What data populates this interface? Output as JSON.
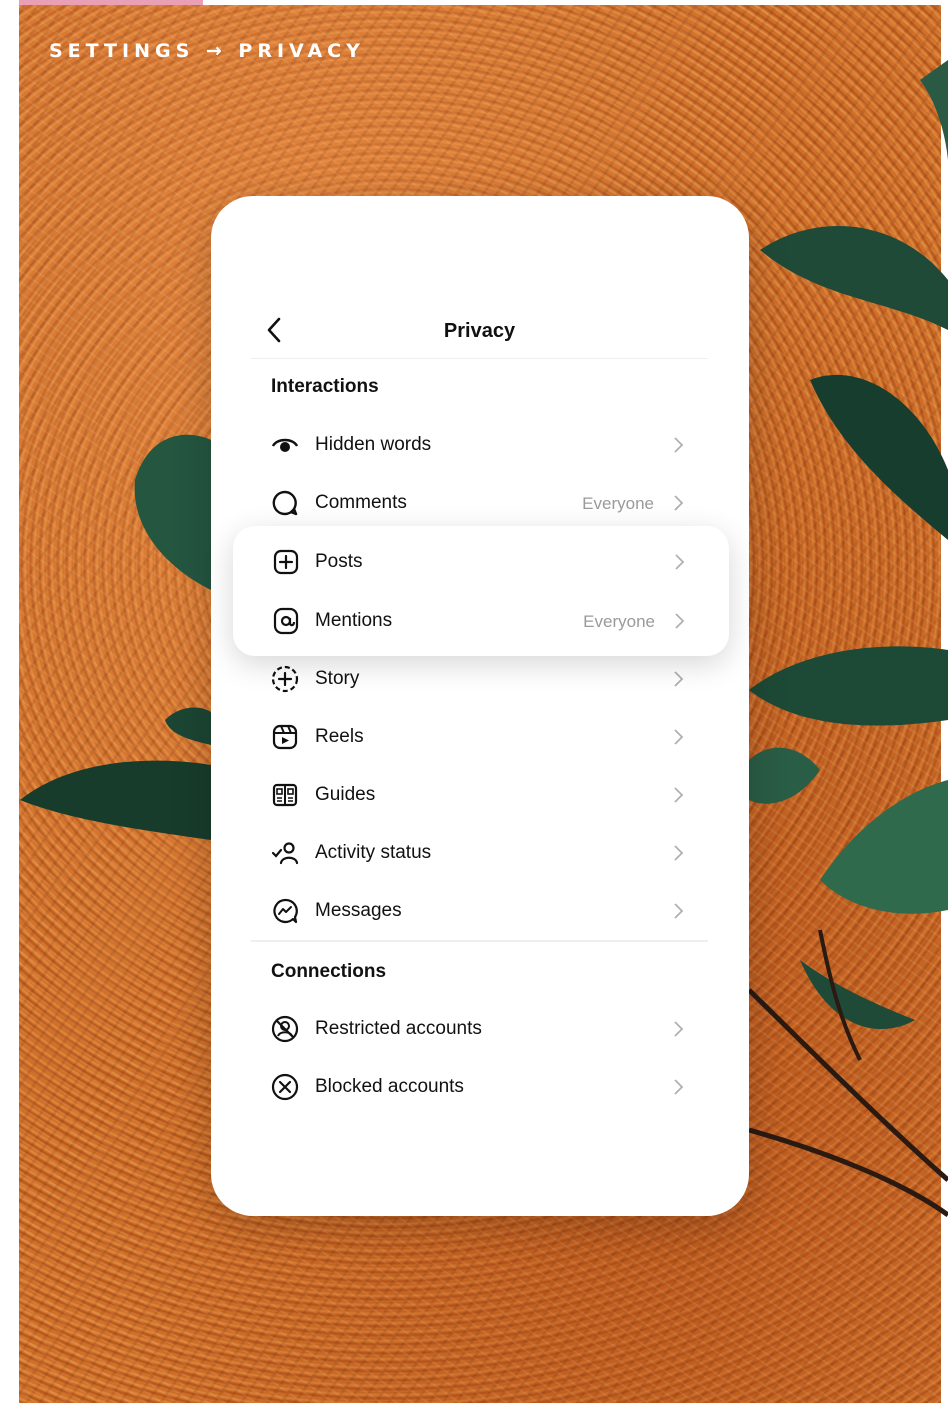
{
  "breadcrumb": "SETTINGS → PRIVACY",
  "colors": {
    "accent": "#e9a0b5",
    "background": "#c8651f"
  },
  "header": {
    "title": "Privacy",
    "back_icon": "chevron-left-icon"
  },
  "sections": {
    "interactions": "Interactions",
    "connections": "Connections"
  },
  "items": [
    {
      "label": "Hidden words",
      "value": "",
      "icon": "eye-icon"
    },
    {
      "label": "Comments",
      "value": "Everyone",
      "icon": "comment-icon"
    },
    {
      "label": "Posts",
      "value": "",
      "icon": "plus-square-icon"
    },
    {
      "label": "Mentions",
      "value": "Everyone",
      "icon": "at-icon"
    },
    {
      "label": "Story",
      "value": "",
      "icon": "story-add-icon"
    },
    {
      "label": "Reels",
      "value": "",
      "icon": "reels-icon"
    },
    {
      "label": "Guides",
      "value": "",
      "icon": "guides-icon"
    },
    {
      "label": "Activity status",
      "value": "",
      "icon": "activity-status-icon"
    },
    {
      "label": "Messages",
      "value": "",
      "icon": "messenger-icon"
    },
    {
      "label": "Restricted accounts",
      "value": "",
      "icon": "restricted-icon"
    },
    {
      "label": "Blocked accounts",
      "value": "",
      "icon": "blocked-icon"
    }
  ]
}
